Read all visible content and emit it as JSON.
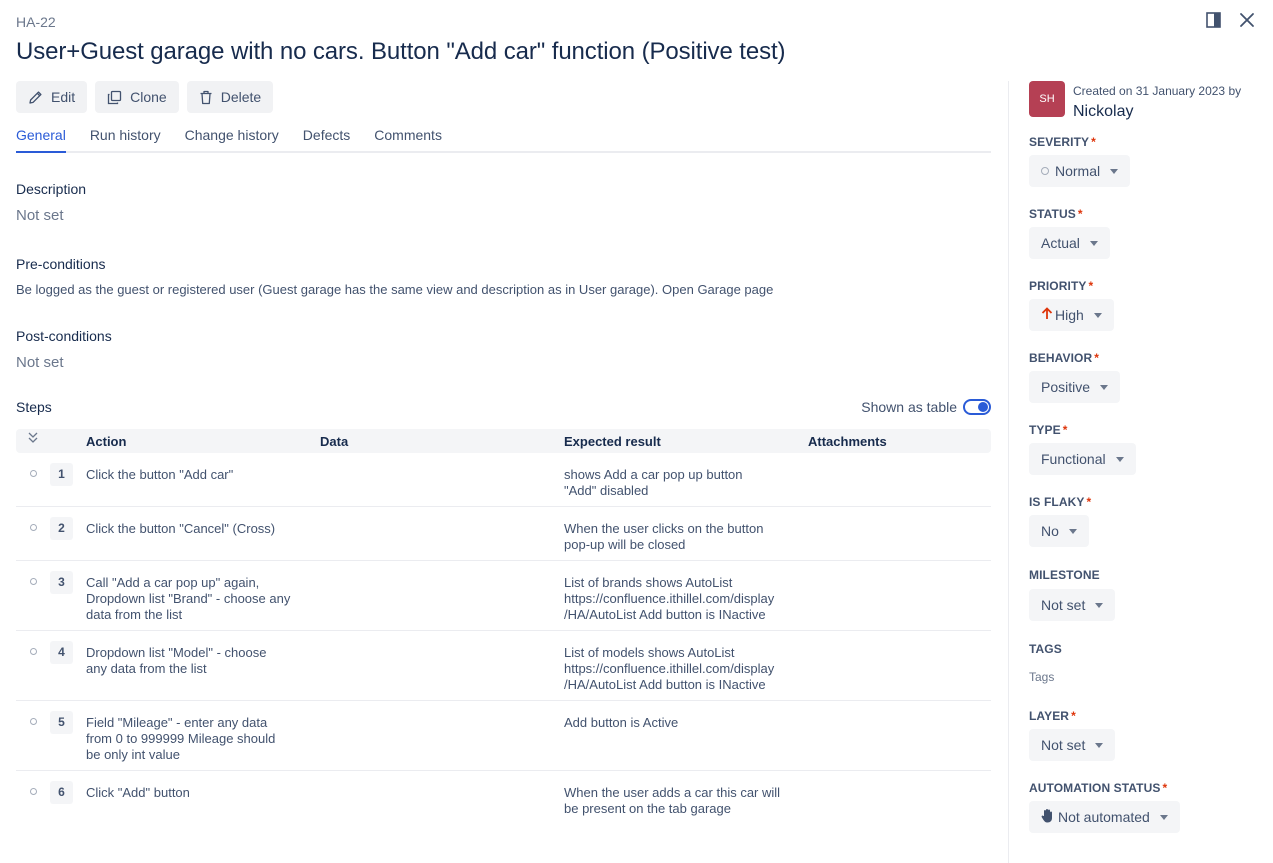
{
  "case": {
    "id": "HA-22",
    "title": "User+Guest garage with no cars. Button \"Add car\" function (Positive test)"
  },
  "toolbar": {
    "edit": "Edit",
    "clone": "Clone",
    "delete": "Delete"
  },
  "tabs": [
    "General",
    "Run history",
    "Change history",
    "Defects",
    "Comments"
  ],
  "general": {
    "description_label": "Description",
    "description_value": "Not set",
    "preconditions_label": "Pre-conditions",
    "preconditions_value": "Be logged as the guest or registered user (Guest garage has the same view and description as in User garage). Open Garage page",
    "postconditions_label": "Post-conditions",
    "postconditions_value": "Not set",
    "steps_label": "Steps",
    "shown_as_table": "Shown as table"
  },
  "steps_table": {
    "columns": [
      "Action",
      "Data",
      "Expected result",
      "Attachments"
    ],
    "rows": [
      {
        "num": "1",
        "action": "Click the button \"Add car\"",
        "data": "",
        "expected": "shows Add a car pop up button\n\"Add\" disabled"
      },
      {
        "num": "2",
        "action": "Click the button \"Cancel\" (Cross)",
        "data": "",
        "expected": "When the user clicks on the button\npop-up will be closed"
      },
      {
        "num": "3",
        "action": "Call \"Add a car pop up\" again,\nDropdown list \"Brand\" - choose any\ndata from the list",
        "data": "",
        "expected": "List of brands shows AutoList\nhttps://confluence.ithillel.com/display\n/HA/AutoList Add button is INactive"
      },
      {
        "num": "4",
        "action": "Dropdown list \"Model\" - choose\nany data from the list",
        "data": "",
        "expected": "List of models shows AutoList\nhttps://confluence.ithillel.com/display\n/HA/AutoList Add button is INactive"
      },
      {
        "num": "5",
        "action": "Field \"Mileage\" - enter any data\nfrom 0 to 999999 Mileage should\nbe only int value",
        "data": "",
        "expected": "Add button is Active"
      },
      {
        "num": "6",
        "action": "Click \"Add\" button",
        "data": "",
        "expected": "When the user adds a car this car will\nbe present on the tab garage"
      }
    ]
  },
  "sidebar": {
    "avatar_initials": "SH",
    "created_text": "Created on 31 January 2023 by",
    "creator": "Nickolay",
    "severity_label": "SEVERITY",
    "severity": "Normal",
    "status_label": "STATUS",
    "status": "Actual",
    "priority_label": "PRIORITY",
    "priority": "High",
    "behavior_label": "BEHAVIOR",
    "behavior": "Positive",
    "type_label": "TYPE",
    "type": "Functional",
    "is_flaky_label": "IS FLAKY",
    "is_flaky": "No",
    "milestone_label": "MILESTONE",
    "milestone": "Not set",
    "tags_label": "TAGS",
    "tags_placeholder": "Tags",
    "layer_label": "LAYER",
    "layer": "Not set",
    "automation_label": "AUTOMATION STATUS",
    "automation": "Not automated",
    "required_mark": "*"
  },
  "colors": {
    "accent": "#2a5bd7",
    "avatar": "#b54054",
    "priority_high": "#de350b",
    "required": "#de350b"
  }
}
